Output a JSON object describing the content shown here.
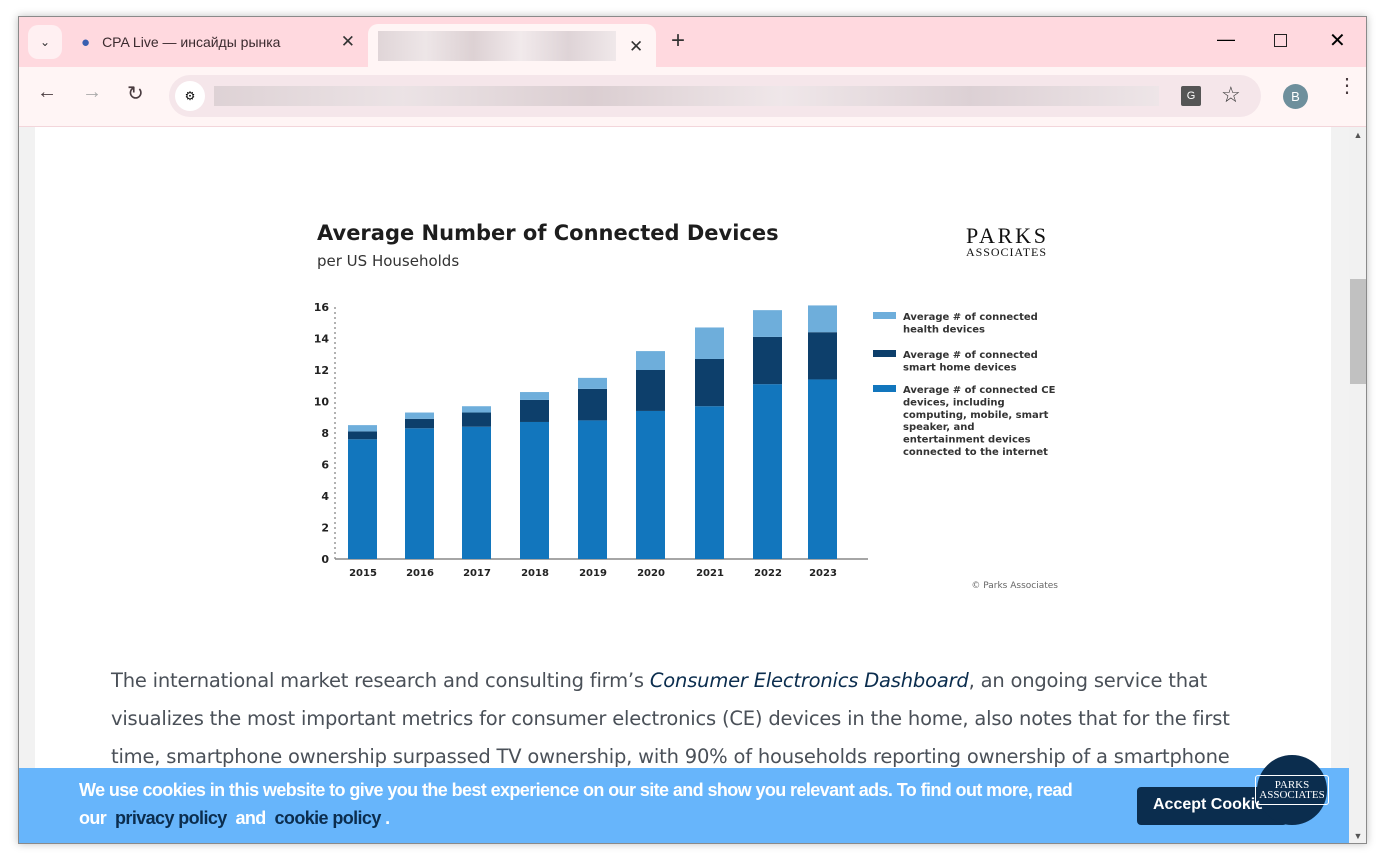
{
  "browser": {
    "tabs": [
      {
        "title": "CPA Live — инсайды рынка",
        "icon": "raccoon-favicon"
      },
      {
        "title": "",
        "active": true
      }
    ],
    "new_tab": "+",
    "profile_initial": "B",
    "colors": {
      "tab_bar": "#ffd9df",
      "toolbar": "#fff5f5"
    }
  },
  "chart_data": {
    "type": "bar",
    "stacked": true,
    "title": "Average Number of Connected Devices",
    "subtitle": "per US Households",
    "logo": "PARKS ASSOCIATES",
    "credit": "© Parks Associates",
    "categories": [
      "2015",
      "2016",
      "2017",
      "2018",
      "2019",
      "2020",
      "2021",
      "2022",
      "2023"
    ],
    "ylim": [
      0,
      16
    ],
    "yticks": [
      "0",
      "2",
      "4",
      "6",
      "8",
      "10",
      "12",
      "14",
      "16"
    ],
    "legend_position": "right",
    "series": [
      {
        "name": "Average # of connected CE devices, including computing, mobile, smart speaker, and entertainment devices connected to the internet",
        "color": "#1276bd",
        "values": [
          7.6,
          8.3,
          8.4,
          8.7,
          8.8,
          9.4,
          9.7,
          11.1,
          11.4
        ]
      },
      {
        "name": "Average # of connected smart home devices",
        "color": "#0d3f6b",
        "values": [
          0.5,
          0.6,
          0.9,
          1.4,
          2.0,
          2.6,
          3.0,
          3.0,
          3.0
        ]
      },
      {
        "name": "Average # of connected health devices",
        "color": "#6eaedb",
        "values": [
          0.4,
          0.4,
          0.4,
          0.5,
          0.7,
          1.2,
          2.0,
          1.7,
          1.7
        ]
      }
    ],
    "legend_lines": [
      [
        "Average # of connected",
        "health devices"
      ],
      [
        "Average # of connected",
        "smart home devices"
      ],
      [
        "Average # of connected CE",
        "devices, including",
        "computing, mobile, smart",
        "speaker, and",
        "entertainment devices",
        "connected to the internet"
      ]
    ]
  },
  "article": {
    "p1_before": "The international market research and consulting firm’s ",
    "p1_link": "Consumer Electronics Dashboard",
    "p1_after": ", an ongoing service that",
    "line2": "visualizes the most important metrics for consumer electronics (CE) devices in the home, also notes that for the first",
    "line3": "time, smartphone ownership surpassed TV ownership, with 90% of households reporting ownership of a smartphone"
  },
  "cookie": {
    "text": "We use cookies in this website to give you the best experience on our site and show you relevant ads. To find out more, read",
    "our": "our",
    "privacy": "privacy policy",
    "and": "and",
    "cookie_policy": "cookie policy",
    "end": ".",
    "accept": "Accept Cookies",
    "chat_logo": "PARKS ASSOCIATES"
  }
}
